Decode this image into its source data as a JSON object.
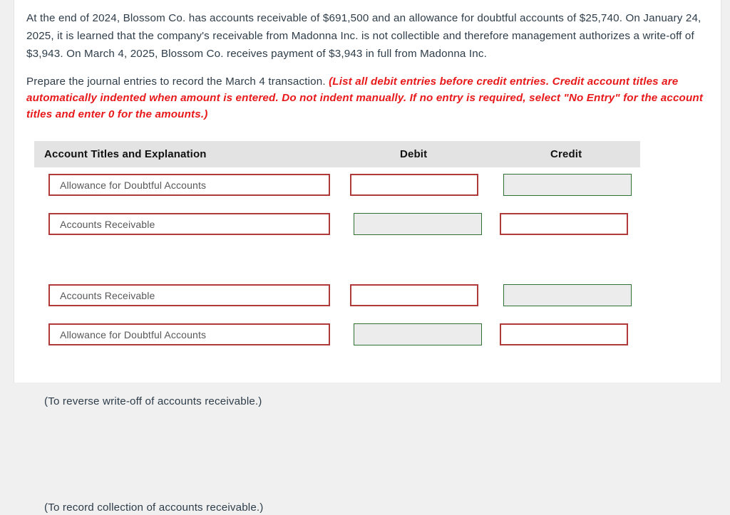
{
  "problem": {
    "statement": "At the end of 2024, Blossom Co. has accounts receivable of $691,500 and an allowance for doubtful accounts of $25,740. On January 24, 2025, it is learned that the company's receivable from Madonna Inc. is not collectible and therefore management authorizes a write-off of $3,943. On March 4, 2025, Blossom Co. receives payment of $3,943 in full from Madonna Inc.",
    "instruction_plain": "Prepare the journal entries to record the March 4 transaction.",
    "instruction_italic": "(List all debit entries before credit entries. Credit account titles are automatically indented when amount is entered. Do not indent manually. If no entry is required, select \"No Entry\" for the account titles and enter 0 for the amounts.)"
  },
  "table": {
    "headers": {
      "account": "Account Titles and Explanation",
      "debit": "Debit",
      "credit": "Credit"
    },
    "rows": [
      {
        "account_title": "Allowance for Doubtful Accounts",
        "debit_value": "",
        "credit_value": "",
        "debit_state": "active",
        "credit_state": "disabled"
      },
      {
        "account_title": "Accounts Receivable",
        "debit_value": "",
        "credit_value": "",
        "debit_state": "disabled",
        "credit_state": "active"
      },
      {
        "account_title": "Accounts Receivable",
        "debit_value": "",
        "credit_value": "",
        "debit_state": "active",
        "credit_state": "disabled"
      },
      {
        "account_title": "Allowance for Doubtful Accounts",
        "debit_value": "",
        "credit_value": "",
        "debit_state": "disabled",
        "credit_state": "active"
      }
    ],
    "explanations": [
      "(To reverse write-off of accounts receivable.)",
      "(To record collection of accounts receivable.)"
    ]
  },
  "colors": {
    "field_border_active": "#b03a3a",
    "field_border_disabled": "#2e7031",
    "field_fill_disabled": "#ececec",
    "instruction_red": "#e8191b",
    "header_band": "#e3e3e3",
    "body_text": "#2e3d49"
  }
}
